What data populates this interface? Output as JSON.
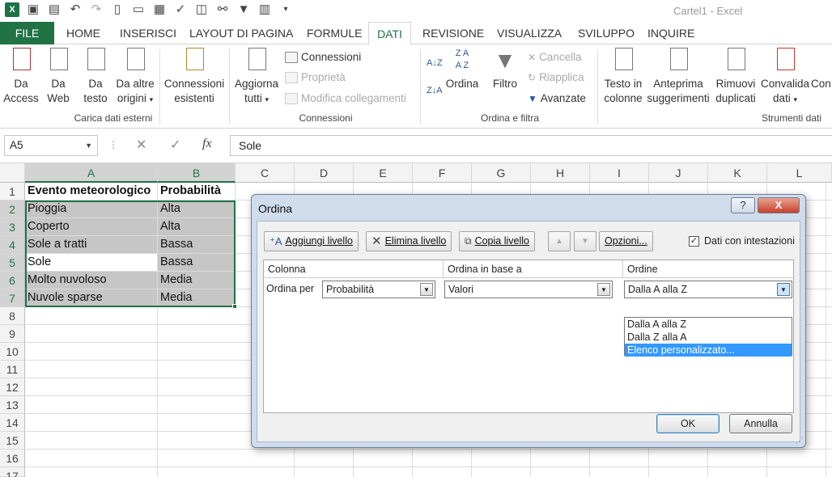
{
  "window": {
    "title": "Cartel1 - Excel"
  },
  "tabs": [
    "FILE",
    "HOME",
    "INSERISCI",
    "LAYOUT DI PAGINA",
    "FORMULE",
    "DATI",
    "REVISIONE",
    "VISUALIZZA",
    "SVILUPPO",
    "INQUIRE"
  ],
  "ribbon": {
    "get_data": {
      "access_1": "Da",
      "access_2": "Access",
      "web_1": "Da",
      "web_2": "Web",
      "text_1": "Da",
      "text_2": "testo",
      "other_1": "Da altre",
      "other_2": "origini",
      "group": "Carica dati esterni"
    },
    "existing": {
      "line1": "Connessioni",
      "line2": "esistenti"
    },
    "connections": {
      "refresh_1": "Aggiorna",
      "refresh_2": "tutti",
      "connections": "Connessioni",
      "properties": "Proprietà",
      "edit_links": "Modifica collegamenti",
      "group": "Connessioni"
    },
    "sort_filter": {
      "sort": "Ordina",
      "filter": "Filtro",
      "clear": "Cancella",
      "reapply": "Riapplica",
      "advanced": "Avanzate",
      "group": "Ordina e filtra"
    },
    "tools": {
      "t2c_1": "Testo in",
      "t2c_2": "colonne",
      "flash_1": "Anteprima",
      "flash_2": "suggerimenti",
      "dup_1": "Rimuovi",
      "dup_2": "duplicati",
      "valid_1": "Convalida",
      "valid_2": "dati",
      "cons": "Con",
      "group": "Strumenti dati"
    }
  },
  "formula_bar": {
    "name_box": "A5",
    "cancel": "✕",
    "enter": "✓",
    "fx": "fx",
    "content": "Sole"
  },
  "columns": [
    "A",
    "B",
    "C",
    "D",
    "E",
    "F",
    "G",
    "H",
    "I",
    "J",
    "K",
    "L"
  ],
  "rows": [
    "1",
    "2",
    "3",
    "4",
    "5",
    "6",
    "7",
    "8",
    "9",
    "10",
    "11",
    "12",
    "13",
    "14",
    "15",
    "16",
    "17"
  ],
  "sheet": {
    "header": [
      "Evento meteorologico",
      "Probabilità"
    ],
    "data": [
      [
        "Pioggia",
        "Alta"
      ],
      [
        "Coperto",
        "Alta"
      ],
      [
        "Sole a tratti",
        "Bassa"
      ],
      [
        "Sole",
        "Bassa"
      ],
      [
        "Molto nuvoloso",
        "Media"
      ],
      [
        "Nuvole sparse",
        "Media"
      ]
    ]
  },
  "dialog": {
    "title": "Ordina",
    "help": "?",
    "close": "X",
    "add_level": "Aggiungi livello",
    "delete_level": "Elimina livello",
    "copy_level": "Copia livello",
    "options": "Opzioni...",
    "headers_checkbox": "Dati con intestazioni",
    "headers_checked": "✓",
    "col_header": "Colonna",
    "sort_on_header": "Ordina in base a",
    "order_header": "Ordine",
    "sort_by_label": "Ordina per",
    "column_value": "Probabilità",
    "sort_on_value": "Valori",
    "order_value": "Dalla A alla Z",
    "order_options": [
      "Dalla A alla Z",
      "Dalla Z alla A",
      "Elenco personalizzato..."
    ],
    "ok": "OK",
    "cancel": "Annulla"
  },
  "colors": {
    "excel_green": "#217346",
    "selection_shade": "#c6c6c6",
    "dropdown_highlight": "#3399ff"
  }
}
